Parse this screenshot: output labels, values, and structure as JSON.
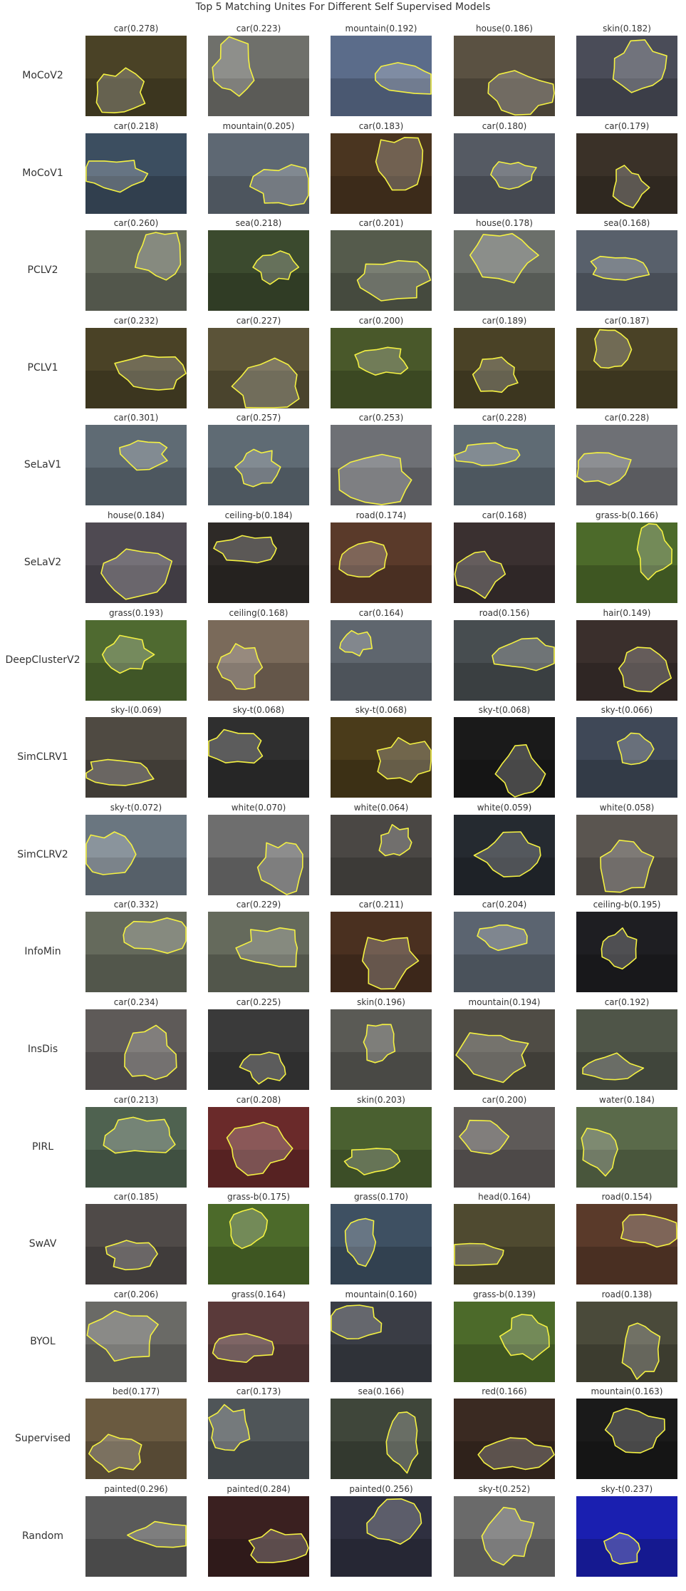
{
  "title": "Top 5 Matching Unites For Different Self Supervised Models",
  "rows": [
    {
      "model": "MoCoV2",
      "cells": [
        {
          "label": "car(0.278)",
          "bg": "#4a4226"
        },
        {
          "label": "car(0.223)",
          "bg": "#6f706b"
        },
        {
          "label": "mountain(0.192)",
          "bg": "#5b6c8a"
        },
        {
          "label": "house(0.186)",
          "bg": "#5a5142"
        },
        {
          "label": "skin(0.182)",
          "bg": "#4a4c58"
        }
      ]
    },
    {
      "model": "MoCoV1",
      "cells": [
        {
          "label": "car(0.218)",
          "bg": "#3c4e60"
        },
        {
          "label": "mountain(0.205)",
          "bg": "#5e6873"
        },
        {
          "label": "car(0.183)",
          "bg": "#4a3520"
        },
        {
          "label": "car(0.180)",
          "bg": "#555a63"
        },
        {
          "label": "car(0.179)",
          "bg": "#3a3128"
        }
      ]
    },
    {
      "model": "PCLV2",
      "cells": [
        {
          "label": "car(0.260)",
          "bg": "#656a5c"
        },
        {
          "label": "sea(0.218)",
          "bg": "#3b4a2e"
        },
        {
          "label": "car(0.201)",
          "bg": "#555b4c"
        },
        {
          "label": "house(0.178)",
          "bg": "#6b6f6a"
        },
        {
          "label": "sea(0.168)",
          "bg": "#58606b"
        }
      ]
    },
    {
      "model": "PCLV1",
      "cells": [
        {
          "label": "car(0.232)",
          "bg": "#4a4226"
        },
        {
          "label": "car(0.227)",
          "bg": "#5b5338"
        },
        {
          "label": "car(0.200)",
          "bg": "#49582a"
        },
        {
          "label": "car(0.189)",
          "bg": "#4a4226"
        },
        {
          "label": "car(0.187)",
          "bg": "#4a4226"
        }
      ]
    },
    {
      "model": "SeLaV1",
      "cells": [
        {
          "label": "car(0.301)",
          "bg": "#5f6b74"
        },
        {
          "label": "car(0.257)",
          "bg": "#5f6b74"
        },
        {
          "label": "car(0.253)",
          "bg": "#6e7075"
        },
        {
          "label": "car(0.228)",
          "bg": "#5f6b74"
        },
        {
          "label": "car(0.228)",
          "bg": "#6e7075"
        }
      ]
    },
    {
      "model": "SeLaV2",
      "cells": [
        {
          "label": "house(0.184)",
          "bg": "#4f4a52"
        },
        {
          "label": "ceiling-b(0.184)",
          "bg": "#2e2a27"
        },
        {
          "label": "road(0.174)",
          "bg": "#5a3a2a"
        },
        {
          "label": "car(0.168)",
          "bg": "#3a3030"
        },
        {
          "label": "grass-b(0.166)",
          "bg": "#4c6a2a"
        }
      ]
    },
    {
      "model": "DeepClusterV2",
      "cells": [
        {
          "label": "grass(0.193)",
          "bg": "#4f6a30"
        },
        {
          "label": "ceiling(0.168)",
          "bg": "#7a6a5a"
        },
        {
          "label": "car(0.164)",
          "bg": "#5f666e"
        },
        {
          "label": "road(0.156)",
          "bg": "#474d50"
        },
        {
          "label": "hair(0.149)",
          "bg": "#3a2f2c"
        }
      ]
    },
    {
      "model": "SimCLRV1",
      "cells": [
        {
          "label": "sky-l(0.069)",
          "bg": "#4f4a42"
        },
        {
          "label": "sky-t(0.068)",
          "bg": "#2f2f2f"
        },
        {
          "label": "sky-t(0.068)",
          "bg": "#4a3b1a"
        },
        {
          "label": "sky-t(0.068)",
          "bg": "#1a1a1a"
        },
        {
          "label": "sky-t(0.066)",
          "bg": "#3f4857"
        }
      ]
    },
    {
      "model": "SimCLRV2",
      "cells": [
        {
          "label": "sky-t(0.072)",
          "bg": "#6a7680"
        },
        {
          "label": "white(0.070)",
          "bg": "#6e6e6e"
        },
        {
          "label": "white(0.064)",
          "bg": "#4a4744"
        },
        {
          "label": "white(0.059)",
          "bg": "#252a30"
        },
        {
          "label": "white(0.058)",
          "bg": "#5a5550"
        }
      ]
    },
    {
      "model": "InfoMin",
      "cells": [
        {
          "label": "car(0.332)",
          "bg": "#656a5c"
        },
        {
          "label": "car(0.229)",
          "bg": "#656a5c"
        },
        {
          "label": "car(0.211)",
          "bg": "#4a3020"
        },
        {
          "label": "car(0.204)",
          "bg": "#5b6470"
        },
        {
          "label": "ceiling-b(0.195)",
          "bg": "#1e1e22"
        }
      ]
    },
    {
      "model": "InsDis",
      "cells": [
        {
          "label": "car(0.234)",
          "bg": "#5e5a58"
        },
        {
          "label": "car(0.225)",
          "bg": "#3a3a3a"
        },
        {
          "label": "skin(0.196)",
          "bg": "#5a5a55"
        },
        {
          "label": "mountain(0.194)",
          "bg": "#4f4c45"
        },
        {
          "label": "car(0.192)",
          "bg": "#4f5548"
        }
      ]
    },
    {
      "model": "PIRL",
      "cells": [
        {
          "label": "car(0.213)",
          "bg": "#4f6250"
        },
        {
          "label": "car(0.208)",
          "bg": "#6a2a2a"
        },
        {
          "label": "skin(0.203)",
          "bg": "#4a6030"
        },
        {
          "label": "car(0.200)",
          "bg": "#5e5a58"
        },
        {
          "label": "water(0.184)",
          "bg": "#5a6a4a"
        }
      ]
    },
    {
      "model": "SwAV",
      "cells": [
        {
          "label": "car(0.185)",
          "bg": "#4f4a48"
        },
        {
          "label": "grass-b(0.175)",
          "bg": "#4c6a2a"
        },
        {
          "label": "grass(0.170)",
          "bg": "#3e5062"
        },
        {
          "label": "head(0.164)",
          "bg": "#4f4a30"
        },
        {
          "label": "road(0.154)",
          "bg": "#5a3a2a"
        }
      ]
    },
    {
      "model": "BYOL",
      "cells": [
        {
          "label": "car(0.206)",
          "bg": "#6a6a66"
        },
        {
          "label": "grass(0.164)",
          "bg": "#5a3a3a"
        },
        {
          "label": "mountain(0.160)",
          "bg": "#3a3d45"
        },
        {
          "label": "grass-b(0.139)",
          "bg": "#4c6a2a"
        },
        {
          "label": "road(0.138)",
          "bg": "#4a4a3a"
        }
      ]
    },
    {
      "model": "Supervised",
      "cells": [
        {
          "label": "bed(0.177)",
          "bg": "#6a5a40"
        },
        {
          "label": "car(0.173)",
          "bg": "#4f5558"
        },
        {
          "label": "sea(0.166)",
          "bg": "#3f463a"
        },
        {
          "label": "red(0.166)",
          "bg": "#3a2a22"
        },
        {
          "label": "mountain(0.163)",
          "bg": "#1a1a1a"
        }
      ]
    },
    {
      "model": "Random",
      "cells": [
        {
          "label": "painted(0.296)",
          "bg": "#5a5a5a"
        },
        {
          "label": "painted(0.284)",
          "bg": "#3a2020"
        },
        {
          "label": "painted(0.256)",
          "bg": "#2f3040"
        },
        {
          "label": "sky-t(0.252)",
          "bg": "#6a6a6a"
        },
        {
          "label": "sky-t(0.237)",
          "bg": "#1a1fb0"
        }
      ]
    }
  ],
  "outline_color": "#f5f242"
}
